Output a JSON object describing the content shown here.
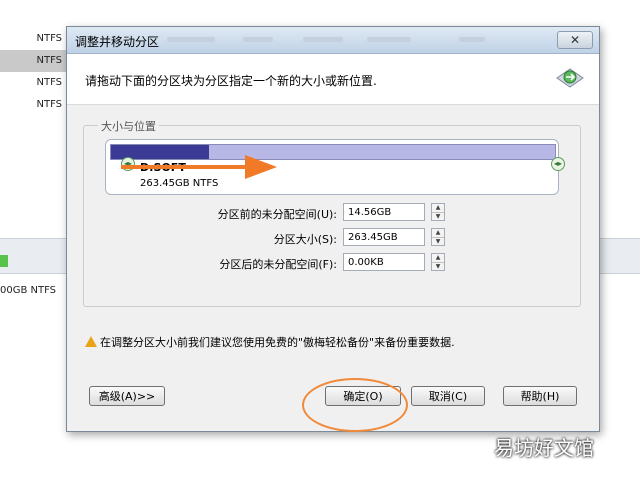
{
  "background": {
    "fs_rows": [
      "NTFS",
      "NTFS",
      "NTFS",
      "NTFS"
    ],
    "bottom_text": "00GB NTFS"
  },
  "dialog": {
    "title": "调整并移动分区",
    "close_label": "✕",
    "header_text": "请拖动下面的分区块为分区指定一个新的大小或新位置.",
    "group_title": "大小与位置",
    "partition": {
      "name": "D:SOFT",
      "size_fs": "263.45GB NTFS",
      "fill_fraction": 0.22
    },
    "fields": [
      {
        "label": "分区前的未分配空间(U):",
        "value": "14.56GB"
      },
      {
        "label": "分区大小(S):",
        "value": "263.45GB"
      },
      {
        "label": "分区后的未分配空间(F):",
        "value": "0.00KB"
      }
    ],
    "warning": "在调整分区大小前我们建议您使用免费的\"傲梅轻松备份\"来备份重要数据.",
    "buttons": {
      "advanced": "高级(A)>>",
      "ok": "确定(O)",
      "cancel": "取消(C)",
      "help": "帮助(H)"
    }
  },
  "watermark": "易坊好文馆",
  "colors": {
    "accent_arrow": "#f07a28",
    "bar_fill": "#3b3b96",
    "bar_empty": "#b8b8e6",
    "annotation_oval": "#f08a3a"
  }
}
